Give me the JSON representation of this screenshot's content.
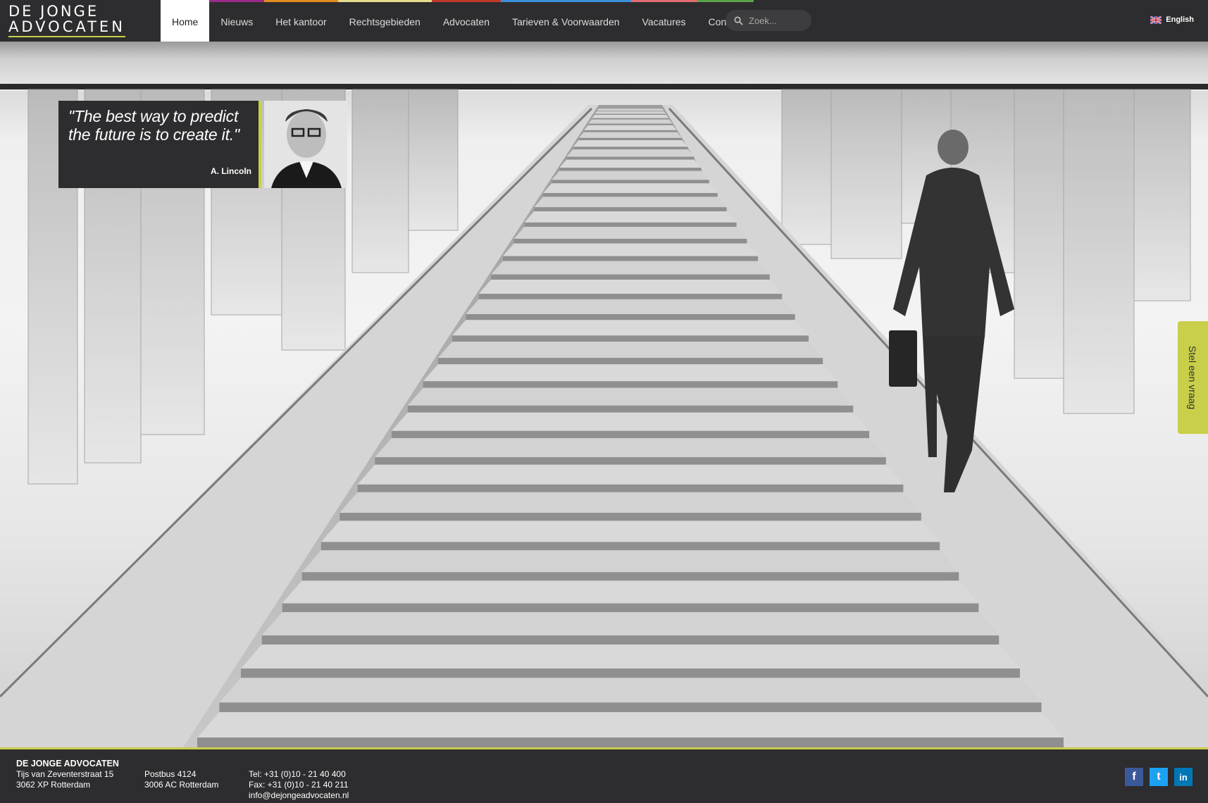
{
  "brand": {
    "line1": "DE JONGE",
    "line2": "ADVOCATEN",
    "accent": "#c9cf4a"
  },
  "nav": {
    "items": [
      {
        "label": "Home",
        "color": "#ffffff",
        "active": true
      },
      {
        "label": "Nieuws",
        "color": "#9b2a8a"
      },
      {
        "label": "Het kantoor",
        "color": "#e48a1f"
      },
      {
        "label": "Rechtsgebieden",
        "color": "#e6dc8c"
      },
      {
        "label": "Advocaten",
        "color": "#c0392b"
      },
      {
        "label": "Tarieven & Voorwaarden",
        "color": "#3b8fd9"
      },
      {
        "label": "Vacatures",
        "color": "#e36b74"
      },
      {
        "label": "Contact",
        "color": "#5aa34a"
      }
    ]
  },
  "search": {
    "placeholder": "Zoek...",
    "icon": "search-icon"
  },
  "language": {
    "label": "English",
    "icon": "uk-flag-icon"
  },
  "hero": {
    "quote": "\"The best way to predict the future is to create it.\"",
    "author": "A. Lincoln"
  },
  "side_tab": {
    "label": "Stel een vraag"
  },
  "footer": {
    "company": "DE JONGE ADVOCATEN",
    "address_line1": "Tijs van Zeventerstraat 15",
    "address_line2": "3062 XP Rotterdam",
    "postbus_line1": "Postbus 4124",
    "postbus_line2": "3006 AC Rotterdam",
    "tel": "Tel: +31 (0)10 - 21 40 400",
    "fax": "Fax: +31 (0)10 - 21 40 211",
    "email": "info@dejongeadvocaten.nl",
    "social": [
      {
        "name": "facebook-icon",
        "glyph": "f",
        "color": "#3b5998"
      },
      {
        "name": "twitter-icon",
        "glyph": "t",
        "color": "#1da1f2"
      },
      {
        "name": "linkedin-icon",
        "glyph": "in",
        "color": "#0077b5"
      }
    ]
  }
}
